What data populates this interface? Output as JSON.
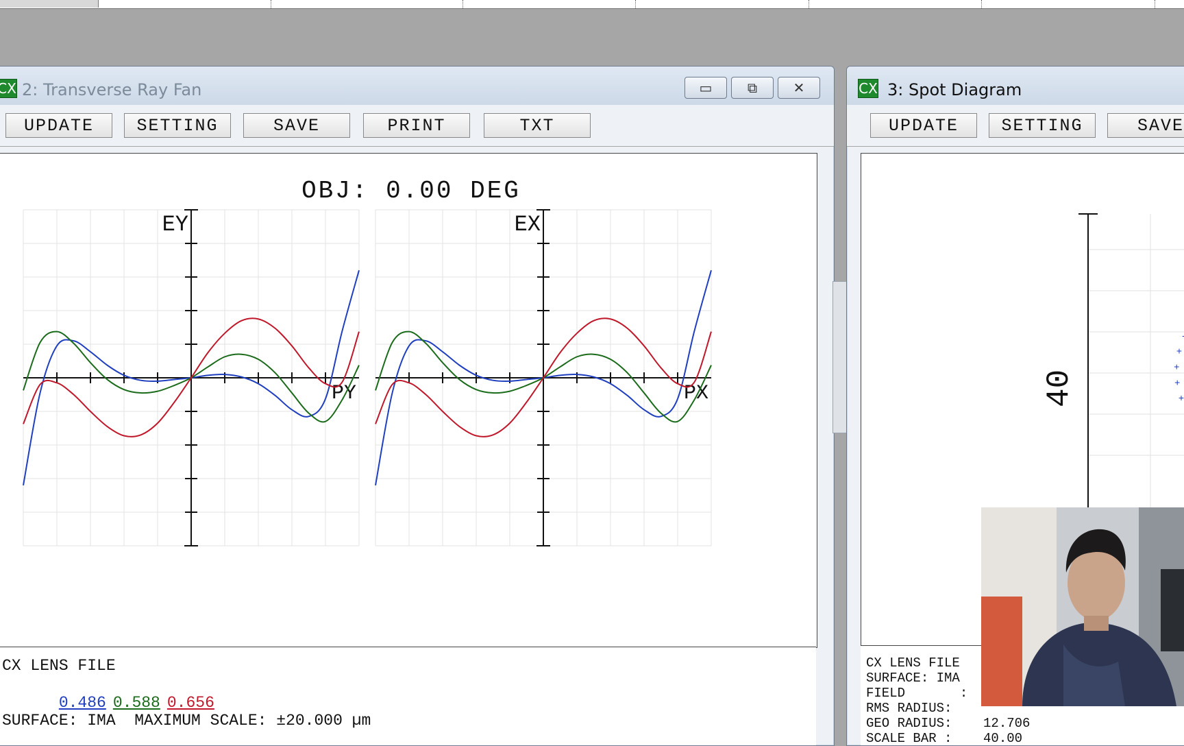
{
  "ray_fan_window": {
    "title": "2: Transverse Ray Fan",
    "icon_text": "CX",
    "toolbar": [
      "UPDATE",
      "SETTING",
      "SAVE",
      "PRINT",
      "TXT"
    ],
    "controls": {
      "minimize": "▭",
      "restore": "⧉",
      "close": "✕"
    },
    "plot_title": "OBJ: 0.00 DEG",
    "footer": {
      "lens_file": "CX LENS FILE",
      "wavelengths": [
        {
          "label": "0.486",
          "color": "#1f3fbf"
        },
        {
          "label": "0.588",
          "color": "#1a6b1a"
        },
        {
          "label": "0.656",
          "color": "#c0182b"
        }
      ],
      "surface_line": "SURFACE: IMA  MAXIMUM SCALE: ±20.000 µm"
    }
  },
  "spot_window": {
    "title": "3: Spot Diagram",
    "icon_text": "CX",
    "toolbar": [
      "UPDATE",
      "SETTING",
      "SAVE"
    ],
    "scale_label": "40",
    "footer_lines": [
      "CX LENS FILE",
      "SURFACE: IMA",
      "FIELD       :",
      "RMS RADIUS:",
      "GEO RADIUS:    12.706",
      "SCALE BAR :    40.00"
    ]
  },
  "chart_data": [
    {
      "type": "line",
      "ylabel": "EY",
      "xlabel": "PY",
      "x": [
        -1,
        -0.9,
        -0.8,
        -0.7,
        -0.6,
        -0.5,
        -0.4,
        -0.3,
        -0.2,
        -0.1,
        0,
        0.1,
        0.2,
        0.3,
        0.4,
        0.5,
        0.6,
        0.7,
        0.8,
        0.9,
        1
      ],
      "ylim": [
        -20,
        20
      ],
      "series": [
        {
          "color": "#1f3fbf",
          "values": [
            -12.8,
            -1.8,
            3.8,
            4.4,
            3.1,
            1.5,
            0.3,
            -0.3,
            -0.4,
            -0.2,
            0,
            0.3,
            0.4,
            0.1,
            -0.7,
            -2.1,
            -3.8,
            -4.6,
            -2.5,
            5.6,
            12.8
          ]
        },
        {
          "color": "#1a6b1a",
          "values": [
            -1.5,
            4.2,
            5.5,
            4.1,
            1.8,
            -0.2,
            -1.4,
            -1.8,
            -1.6,
            -0.9,
            0,
            1.3,
            2.5,
            2.8,
            2.2,
            0.6,
            -1.8,
            -4.2,
            -5.2,
            -2.6,
            1.5
          ]
        },
        {
          "color": "#c0182b",
          "values": [
            -5.5,
            -0.8,
            -0.6,
            -2.0,
            -4.0,
            -5.8,
            -6.9,
            -6.8,
            -5.4,
            -2.9,
            0,
            3.0,
            5.3,
            6.8,
            7.0,
            5.9,
            3.8,
            1.2,
            -0.7,
            -0.5,
            5.5
          ]
        }
      ]
    },
    {
      "type": "line",
      "ylabel": "EX",
      "xlabel": "PX",
      "x": [
        -1,
        -0.9,
        -0.8,
        -0.7,
        -0.6,
        -0.5,
        -0.4,
        -0.3,
        -0.2,
        -0.1,
        0,
        0.1,
        0.2,
        0.3,
        0.4,
        0.5,
        0.6,
        0.7,
        0.8,
        0.9,
        1
      ],
      "ylim": [
        -20,
        20
      ],
      "series": [
        {
          "color": "#1f3fbf",
          "values": [
            -12.8,
            -1.8,
            3.8,
            4.4,
            3.1,
            1.5,
            0.3,
            -0.3,
            -0.4,
            -0.2,
            0,
            0.3,
            0.4,
            0.1,
            -0.7,
            -2.1,
            -3.8,
            -4.6,
            -2.5,
            5.6,
            12.8
          ]
        },
        {
          "color": "#1a6b1a",
          "values": [
            -1.5,
            4.2,
            5.5,
            4.1,
            1.8,
            -0.2,
            -1.4,
            -1.8,
            -1.6,
            -0.9,
            0,
            1.3,
            2.5,
            2.8,
            2.2,
            0.6,
            -1.8,
            -4.2,
            -5.2,
            -2.6,
            1.5
          ]
        },
        {
          "color": "#c0182b",
          "values": [
            -5.5,
            -0.8,
            -0.6,
            -2.0,
            -4.0,
            -5.8,
            -6.9,
            -6.8,
            -5.4,
            -2.9,
            0,
            3.0,
            5.3,
            6.8,
            7.0,
            5.9,
            3.8,
            1.2,
            -0.7,
            -0.5,
            5.5
          ]
        }
      ]
    }
  ]
}
